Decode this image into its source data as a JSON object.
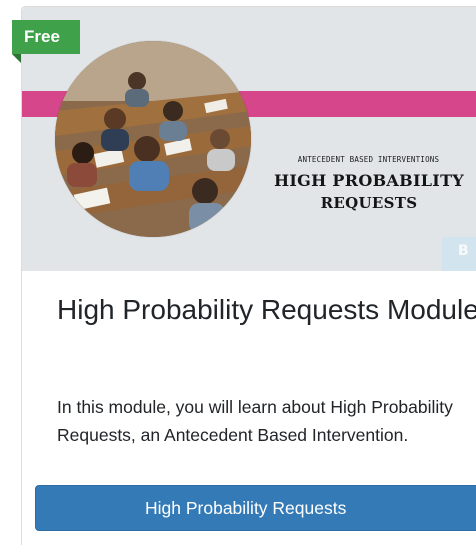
{
  "badge": {
    "label": "Free",
    "color": "#3fa24b"
  },
  "banner": {
    "kicker": "ANTECEDENT BASED INTERVENTIONS",
    "title_line1": "HIGH PROBABILITY",
    "title_line2": "REQUESTS",
    "stripe_color": "#d5468a",
    "background_color": "#e2e5e8",
    "image_icon": "classroom-photo",
    "logo_letter": "B"
  },
  "module": {
    "title": "High Probability Requests Module",
    "description": "In this module, you will learn about High Probability Requests, an Antecedent Based Intervention."
  },
  "button": {
    "label": "High Probability Requests",
    "color": "#337ab7"
  }
}
